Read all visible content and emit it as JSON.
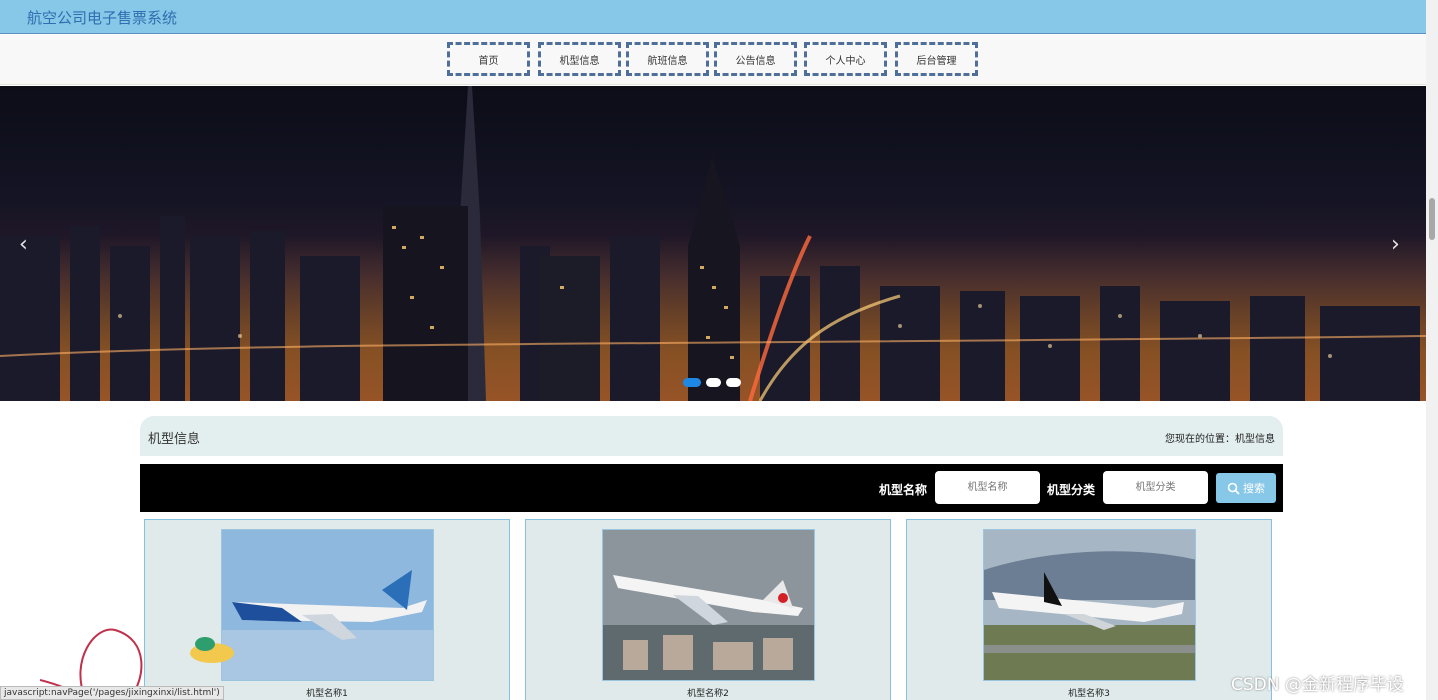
{
  "header": {
    "title": "航空公司电子售票系统"
  },
  "nav": {
    "items": [
      "首页",
      "机型信息",
      "航班信息",
      "公告信息",
      "个人中心",
      "后台管理"
    ]
  },
  "banner": {
    "prev_icon": "chevron-left-icon",
    "next_icon": "chevron-right-icon",
    "slides": 3,
    "active_slide": 1
  },
  "breadcrumb": {
    "title": "机型信息",
    "location": "您现在的位置：机型信息"
  },
  "search": {
    "name_label": "机型名称",
    "name_placeholder": "机型名称",
    "category_label": "机型分类",
    "category_placeholder": "机型分类",
    "button_label": "搜索",
    "button_icon": "search-icon"
  },
  "cards": [
    {
      "name": "机型名称1"
    },
    {
      "name": "机型名称2"
    },
    {
      "name": "机型名称3"
    }
  ],
  "status_bar": {
    "text": "javascript:navPage('/pages/jixingxinxi/list.html')"
  },
  "watermark": "CSDN @金新程序毕设",
  "colors": {
    "header": "#87c7e7",
    "nav_border": "#4e6f9a",
    "button": "#87c7e7",
    "card_bg": "#e0eaeb"
  }
}
